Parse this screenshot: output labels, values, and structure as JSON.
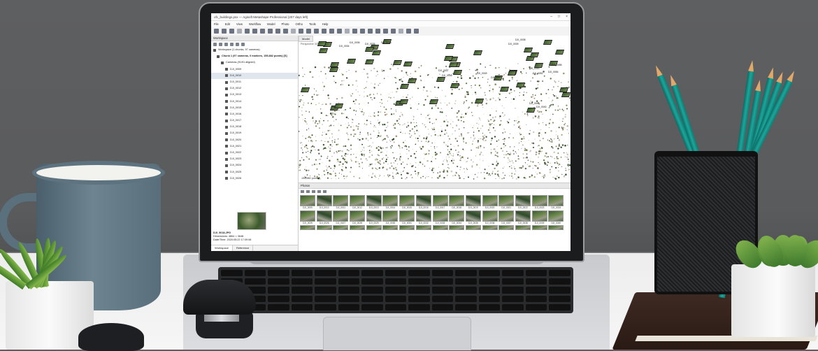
{
  "app": {
    "window_title": "ofc_buildings.psx — Agisoft Metashape Professional (207 days left)",
    "menus": [
      "File",
      "Edit",
      "View",
      "Workflow",
      "Model",
      "Photo",
      "Ortho",
      "Tools",
      "Help"
    ]
  },
  "workspace": {
    "header": "Workspace",
    "summary": "Workspace (1 chunks, 97 cameras)",
    "chunk": "Chunk 1 (97 cameras, 0 markers, 155,882 points) [S]",
    "cameras_group": "Cameras (91/91 aligned)",
    "cameras": [
      "DJI_0009",
      "DJI_0010",
      "DJI_0011",
      "DJI_0012",
      "DJI_0013",
      "DJI_0014",
      "DJI_0015",
      "DJI_0016",
      "DJI_0017",
      "DJI_0018",
      "DJI_0019",
      "DJI_0020",
      "DJI_0021",
      "DJI_0022",
      "DJI_0023",
      "DJI_0024",
      "DJI_0025",
      "DJI_0026"
    ],
    "selected_index": 1,
    "preview_name": "DJI_0018.JPG",
    "dimensions": "Dimensions: 4864 × 3648",
    "datetime": "Date/Time: 2020:05:22 17:09:08",
    "tabs": [
      "Workspace",
      "Reference"
    ]
  },
  "model": {
    "tab": "Model",
    "perspective": "Perspective 30°",
    "points": "155,882 points",
    "camera_labels": [
      "DJI_0036",
      "DJI_0035",
      "DJI_0034",
      "DJI_0033",
      "DJI_0047",
      "DJI_0048",
      "DJI_0049",
      "DJI_0050",
      "DJI_0052",
      "DJI_0053",
      "DJI_0054",
      "DJI_0055",
      "DJI_0041",
      "DJI_0040",
      "DJI_0039",
      "DJI_0038"
    ]
  },
  "photos": {
    "header": "Photos",
    "row1": [
      "DJI_0009",
      "DJI_0010",
      "DJI_0011",
      "DJI_0012",
      "DJI_0013",
      "DJI_0014",
      "DJI_0015",
      "DJI_0016",
      "DJI_0017",
      "DJI_0018",
      "DJI_0019",
      "DJI_0020",
      "DJI_0021",
      "DJI_0022",
      "DJI_0023",
      "DJI_0024"
    ],
    "row2": [
      "DJI_0025",
      "DJI_0026",
      "DJI_0027",
      "DJI_0028",
      "DJI_0029",
      "DJI_0030",
      "DJI_0031",
      "DJI_0032",
      "DJI_0033",
      "DJI_0034",
      "DJI_0035",
      "DJI_0036",
      "DJI_0037",
      "DJI_0038",
      "DJI_0039",
      "DJI_0040"
    ]
  }
}
